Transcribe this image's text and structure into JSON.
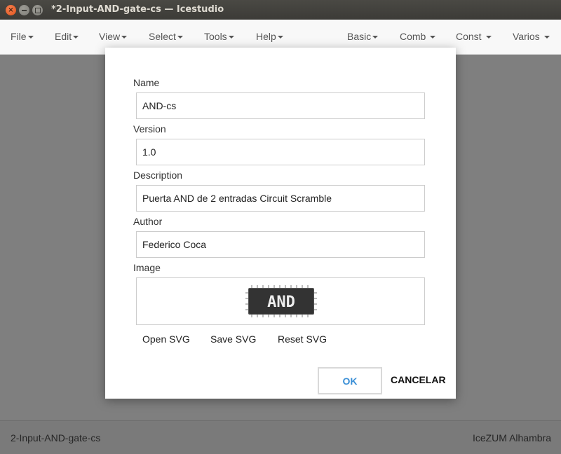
{
  "window": {
    "title": "*2-Input-AND-gate-cs — Icestudio"
  },
  "menubar": {
    "left": [
      {
        "label": "File"
      },
      {
        "label": "Edit"
      },
      {
        "label": "View"
      },
      {
        "label": "Select"
      },
      {
        "label": "Tools"
      },
      {
        "label": "Help"
      }
    ],
    "right": [
      {
        "label": "Basic"
      },
      {
        "label": "Comb"
      },
      {
        "label": "Const"
      },
      {
        "label": "Varios"
      }
    ]
  },
  "dialog": {
    "name_label": "Name",
    "name_value": "AND-cs",
    "version_label": "Version",
    "version_value": "1.0",
    "description_label": "Description",
    "description_value": "Puerta AND de 2 entradas Circuit Scramble",
    "author_label": "Author",
    "author_value": "Federico Coca",
    "image_label": "Image",
    "chip_text": "AND",
    "open_svg": "Open SVG",
    "save_svg": "Save SVG",
    "reset_svg": "Reset SVG",
    "ok": "OK",
    "cancel": "CANCELAR"
  },
  "footer": {
    "project": "2-Input-AND-gate-cs",
    "board": "IceZUM Alhambra"
  },
  "colors": {
    "ok_text": "#3a8fd6",
    "overlay": "#7f7f7f",
    "close_button": "#e2531c"
  }
}
